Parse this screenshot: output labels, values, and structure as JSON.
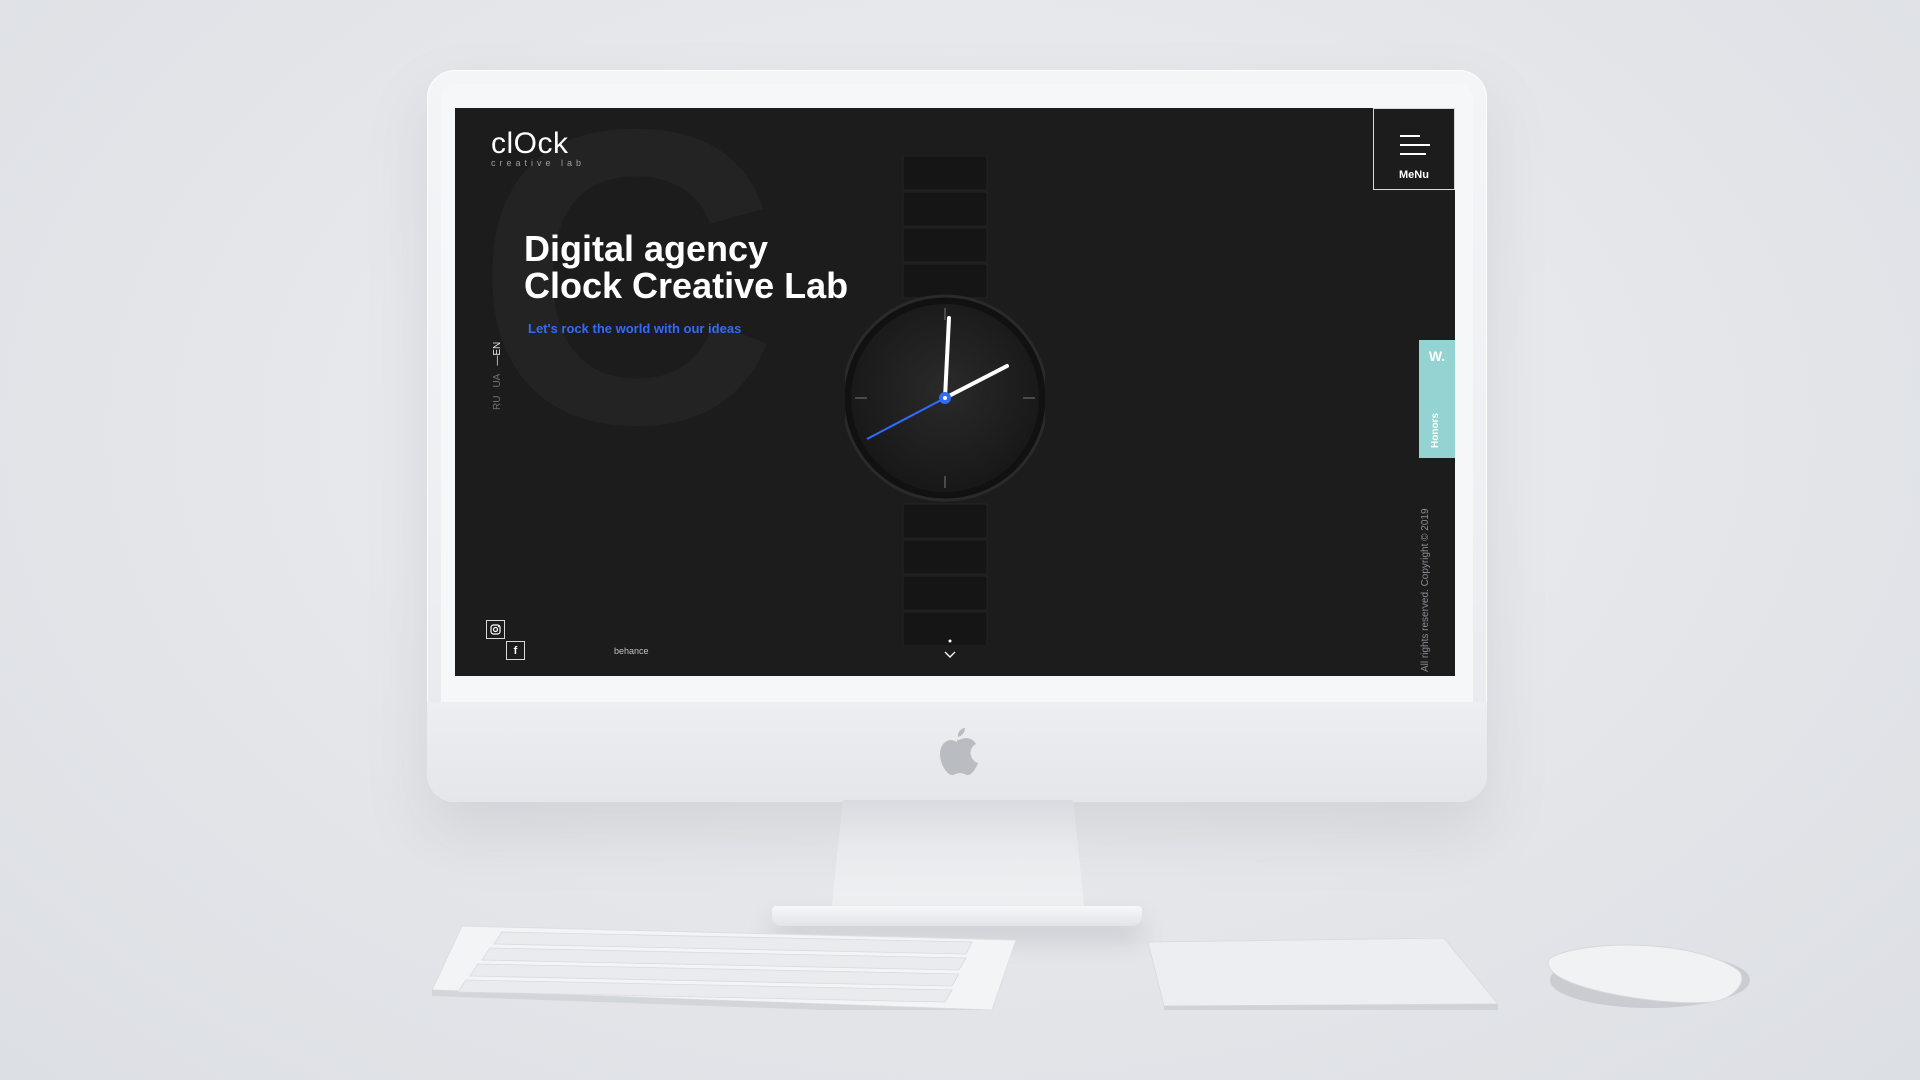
{
  "site": {
    "logo_text": "clOck",
    "logo_subtitle": "creative lab",
    "headline_line1": "Digital agency",
    "headline_line2": "Clock Creative Lab",
    "tagline": "Let's rock the world with our ideas",
    "languages": {
      "ru": "RU",
      "ua": "UA",
      "en": "EN",
      "active": "EN"
    },
    "menu_label": "MeNu",
    "honors": {
      "badge": "W.",
      "label": "Honors"
    },
    "copyright": "All rights reserved. Copyright © 2019",
    "social": {
      "facebook_glyph": "f",
      "behance_label": "behance"
    },
    "background_letter": "C"
  },
  "colors": {
    "screen_bg": "#1c1c1d",
    "accent_blue": "#2f6bff",
    "honors_teal": "#93d3d1",
    "text_white": "#ffffff"
  },
  "icons": [
    "hamburger-icon",
    "instagram-icon",
    "facebook-icon",
    "chevron-down-icon",
    "apple-logo-icon"
  ]
}
